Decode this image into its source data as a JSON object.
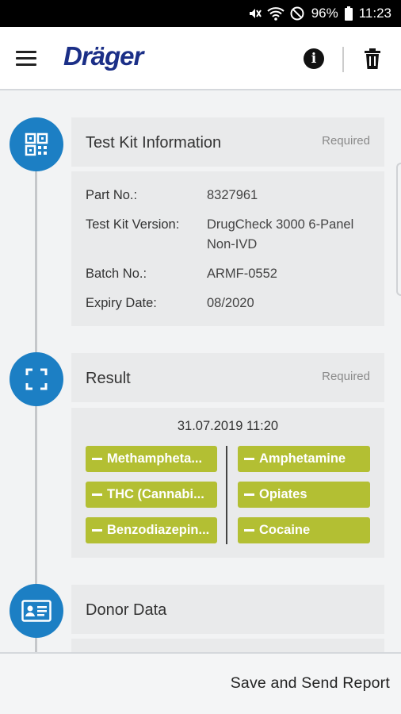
{
  "status_bar": {
    "battery": "96%",
    "time": "11:23"
  },
  "app_bar": {
    "logo": "Dräger"
  },
  "sections": {
    "test_kit": {
      "title": "Test Kit Information",
      "required": "Required",
      "fields": [
        {
          "label": "Part No.:",
          "value": "8327961"
        },
        {
          "label": "Test Kit Version:",
          "value": "DrugCheck 3000 6-Panel Non-IVD"
        },
        {
          "label": "Batch No.:",
          "value": "ARMF-0552"
        },
        {
          "label": "Expiry Date:",
          "value": "08/2020"
        }
      ]
    },
    "result": {
      "title": "Result",
      "required": "Required",
      "datetime": "31.07.2019 11:20",
      "left": [
        "Methampheta...",
        "THC (Cannabi...",
        "Benzodiazepin..."
      ],
      "right": [
        "Amphetamine",
        "Opiates",
        "Cocaine"
      ]
    },
    "donor": {
      "title": "Donor Data"
    }
  },
  "bottom_bar": {
    "send_label": "Save and Send Report"
  },
  "colors": {
    "accent": "#1c7fc4",
    "brand": "#1b2f87",
    "pill": "#b3bf33"
  },
  "icons": [
    "mute-icon",
    "wifi-icon",
    "block-icon",
    "battery-icon",
    "menu-icon",
    "info-icon",
    "trash-icon",
    "qr-code-icon",
    "scan-frame-icon",
    "id-card-icon"
  ]
}
